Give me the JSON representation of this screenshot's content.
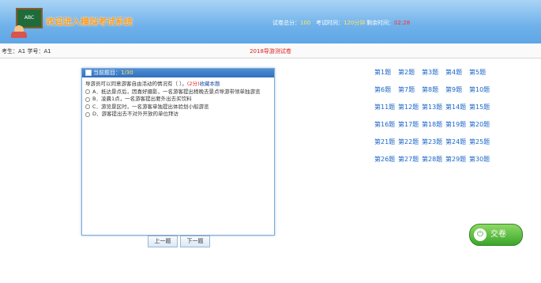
{
  "header": {
    "title": "欢迎进入模拟考试系统",
    "total_label": "试卷总分：",
    "total_value": "100",
    "duration_label": "考试时间：",
    "duration_value": "120分钟",
    "remaining_label": "剩余时间：",
    "remaining_value": "02:28"
  },
  "student": {
    "text": "考生：A1    学号：A1"
  },
  "paper": {
    "name": "2018导游测试卷"
  },
  "question": {
    "header_label": "当前题目：",
    "header_value": "1/30",
    "stem": "导游员可以同意游客自由活动的情况有（ ）。",
    "score": "(2分)",
    "favorite": "收藏本题",
    "options": [
      "A．抵达景点后，因喜好摄影，一名游客提出稍晚去景点导游带领单独游览",
      "B．凌晨1点，一名游客提出要外出去买饮料",
      "C．游览景区时，一名游客单独提出体验划小船游览",
      "D．游客提出去不对外开放的单位拜访"
    ]
  },
  "buttons": {
    "prev": "上一题",
    "next": "下一题",
    "submit": "交卷"
  },
  "nav": [
    "第1题",
    "第2题",
    "第3题",
    "第4题",
    "第5题",
    "第6题",
    "第7题",
    "第8题",
    "第9题",
    "第10题",
    "第11题",
    "第12题",
    "第13题",
    "第14题",
    "第15题",
    "第16题",
    "第17题",
    "第18题",
    "第19题",
    "第20题",
    "第21题",
    "第22题",
    "第23题",
    "第24题",
    "第25题",
    "第26题",
    "第27题",
    "第28题",
    "第29题",
    "第30题"
  ]
}
